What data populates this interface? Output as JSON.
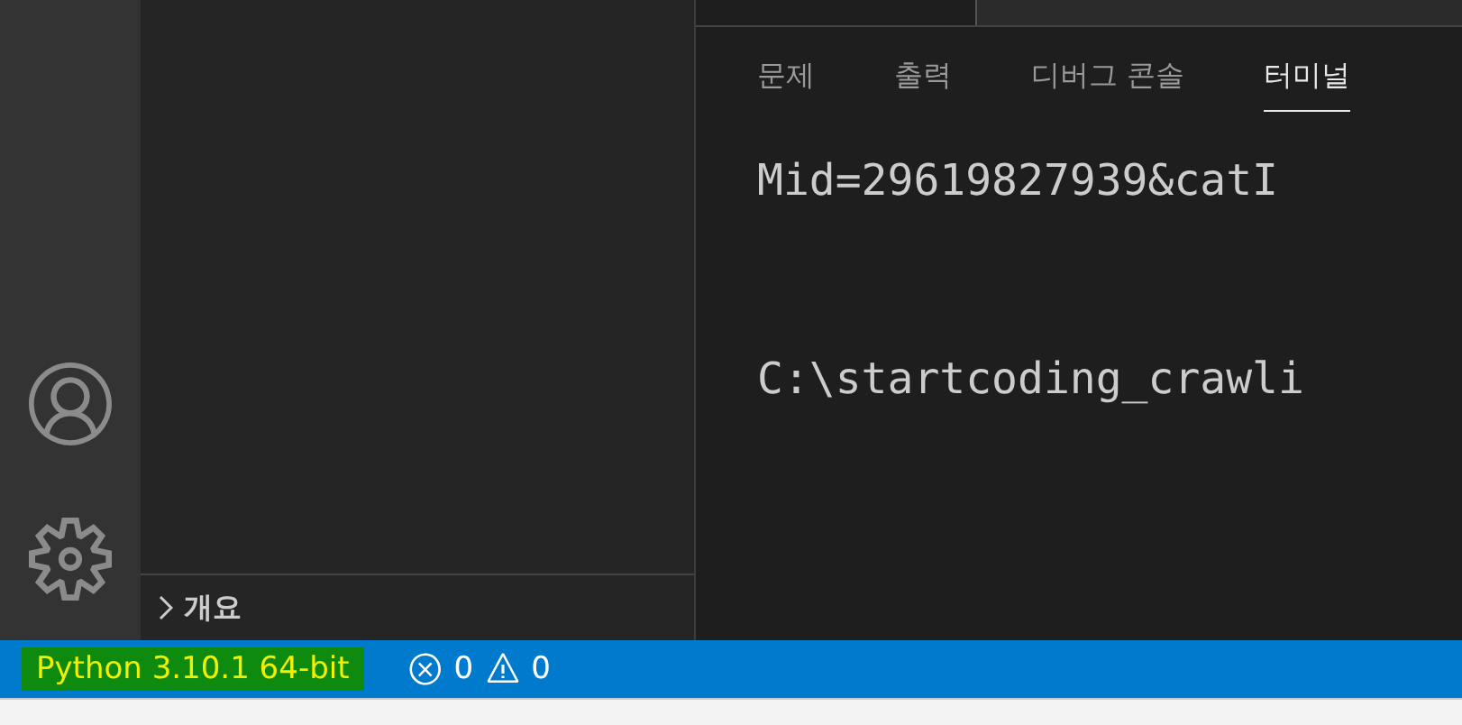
{
  "panel": {
    "tabs": [
      {
        "label": "문제",
        "selected": false
      },
      {
        "label": "출력",
        "selected": false
      },
      {
        "label": "디버그 콘솔",
        "selected": false
      },
      {
        "label": "터미널",
        "selected": true
      }
    ],
    "terminal_lines": [
      "Mid=29619827939&catI",
      "C:\\startcoding_crawli"
    ]
  },
  "sidebar": {
    "outline": {
      "label": "개요",
      "expanded": false
    }
  },
  "status_bar": {
    "interpreter": "Python 3.10.1 64-bit",
    "errors": "0",
    "warnings": "0"
  }
}
